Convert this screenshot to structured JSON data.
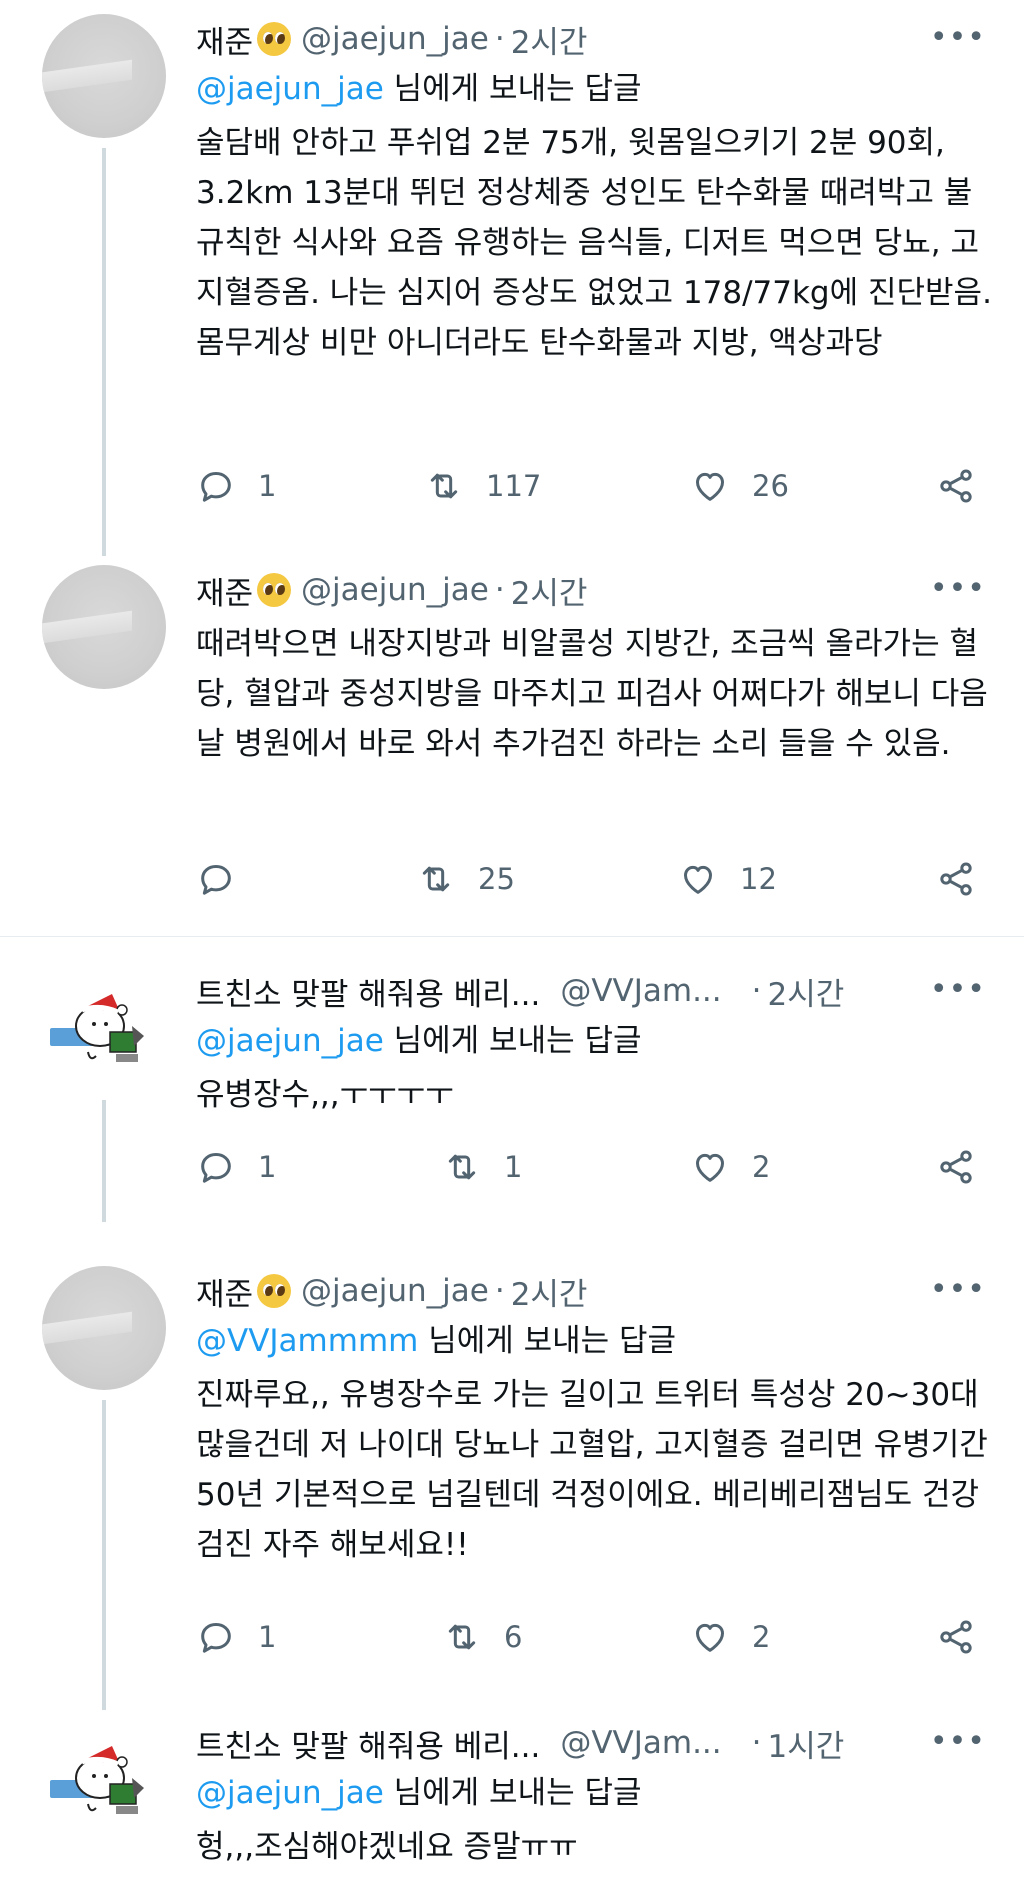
{
  "tweets": [
    {
      "name": "재준",
      "handle": "@jaejun_jae",
      "time": "2시간",
      "reply_mention": "@jaejun_jae",
      "reply_suffix": " 님에게 보내는 답글",
      "text": "술담배 안하고 푸쉬업 2분 75개, 윗몸일으키기 2분 90회, 3.2km 13분대 뛰던 정상체중 성인도 탄수화물 때려박고 불규칙한 식사와 요즘 유행하는 음식들, 디저트 먹으면 당뇨, 고지혈증옴. 나는 심지어 증상도 없었고 178/77kg에 진단받음. 몸무게상 비만 아니더라도 탄수화물과 지방, 액상과당",
      "replies": "1",
      "retweets": "117",
      "likes": "26"
    },
    {
      "name": "재준",
      "handle": "@jaejun_jae",
      "time": "2시간",
      "text": "때려박으면 내장지방과 비알콜성 지방간, 조금씩 올라가는 혈당, 혈압과 중성지방을 마주치고 피검사 어쩌다가 해보니 다음날 병원에서 바로 와서 추가검진 하라는 소리 들을 수 있음.",
      "replies": "",
      "retweets": "25",
      "likes": "12"
    },
    {
      "name": "트친소 맞팔 해줘용 베리...",
      "handle": "@VVJam...",
      "time": "2시간",
      "reply_mention": "@jaejun_jae",
      "reply_suffix": " 님에게 보내는 답글",
      "text": "유병장수,,,ㅜㅜㅜㅜ",
      "replies": "1",
      "retweets": "1",
      "likes": "2"
    },
    {
      "name": "재준",
      "handle": "@jaejun_jae",
      "time": "2시간",
      "reply_mention": "@VVJammmm",
      "reply_suffix": " 님에게 보내는 답글",
      "text": "진짜루요,, 유병장수로 가는 길이고 트위터 특성상 20~30대 많을건데 저 나이대 당뇨나 고혈압, 고지혈증 걸리면 유병기간 50년 기본적으로 넘길텐데 걱정이에요. 베리베리잼님도 건강검진 자주 해보세요!!",
      "replies": "1",
      "retweets": "6",
      "likes": "2"
    },
    {
      "name": "트친소 맞팔 해줘용 베리...",
      "handle": "@VVJam...",
      "time": "1시간",
      "reply_mention": "@jaejun_jae",
      "reply_suffix": " 님에게 보내는 답글",
      "text": "헝,,,조심해야겠네요 증말ㅠㅠ"
    }
  ],
  "icons": {
    "more": "more-icon",
    "reply": "reply-icon",
    "retweet": "retweet-icon",
    "like": "like-icon",
    "share": "share-icon",
    "emoji": "pleading-face-emoji"
  },
  "colors": {
    "link": "#1d9bf0",
    "secondary": "#536471",
    "text": "#0f1419",
    "thread_line": "#cfd9de"
  }
}
